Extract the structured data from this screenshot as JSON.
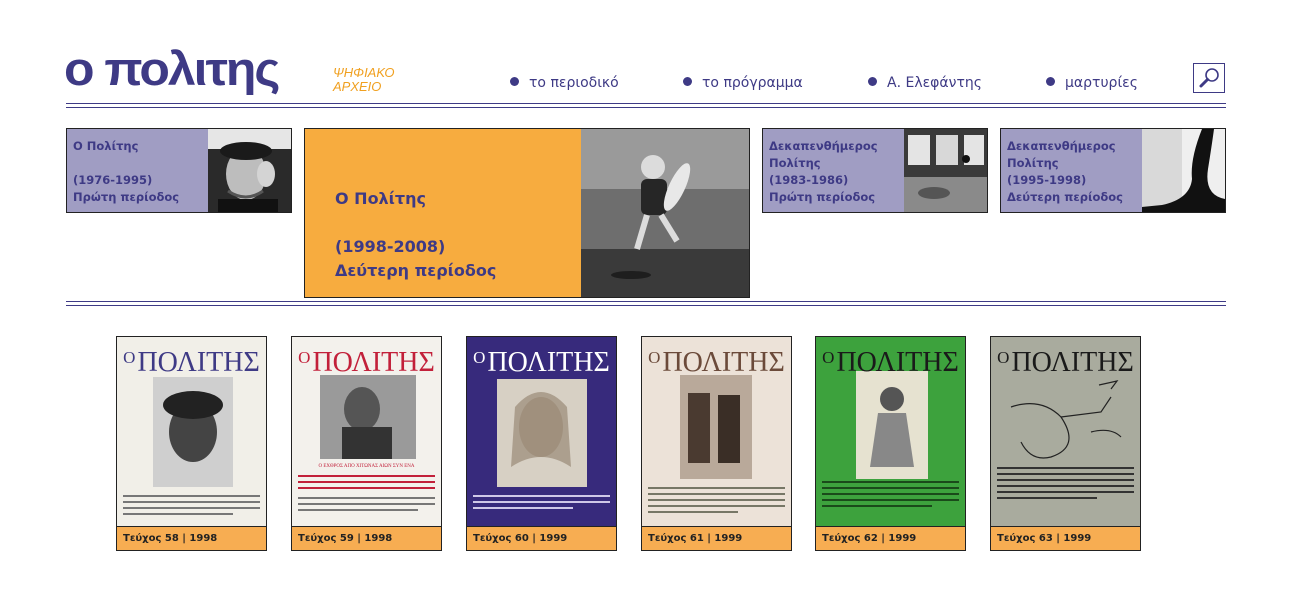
{
  "header": {
    "logo_text": "ο πολιτης",
    "logo_sub_line1": "ΨΗΦΙΑΚΟ",
    "logo_sub_line2": "ΑΡΧΕΙΟ",
    "search_icon": "search-icon"
  },
  "nav": [
    {
      "label": "το περιοδικό"
    },
    {
      "label": "το πρόγραμμα"
    },
    {
      "label": "Α. Ελεφάντης"
    },
    {
      "label": "μαρτυρίες"
    }
  ],
  "periods": [
    {
      "line1": "Ο Πολίτης",
      "line2": "",
      "line3": "(1976-1995)",
      "line4": "Πρώτη περίοδος"
    },
    {
      "line1": "Ο Πολίτης",
      "line2": "",
      "line3": "(1998-2008)",
      "line4": "Δεύτερη περίοδος"
    },
    {
      "line1": "Δεκαπενθήμερος",
      "line2": "Πολίτης",
      "line3": "(1983-1986)",
      "line4": "Πρώτη περίοδος"
    },
    {
      "line1": "Δεκαπενθήμερος",
      "line2": "Πολίτης",
      "line3": "(1995-1998)",
      "line4": "Δεύτερη περίοδος"
    }
  ],
  "issues": [
    {
      "masthead_o": "Ο",
      "masthead": "ΠΟΛΙΤΗΣ",
      "cover_headline": "",
      "caption": "Τεύχος 58 | 1998",
      "masthead_color": "#3e3a85",
      "cover_bg": "#f1efe8"
    },
    {
      "masthead_o": "Ο",
      "masthead": "ΠΟΛΙΤΗΣ",
      "cover_headline": "Ο ΕΧΘΡΟΣ ΑΠΟ ΧΙΤΩΝΑΣ ΑΙΩΝ ΣΥΝ ΕΝΑ",
      "caption": "Τεύχος 59 | 1998",
      "masthead_color": "#c2203a",
      "cover_bg": "#f3f1ec"
    },
    {
      "masthead_o": "Ο",
      "masthead": "ΠΟΛΙΤΗΣ",
      "cover_headline": "",
      "caption": "Τεύχος 60 | 1999",
      "masthead_color": "#ffffff",
      "cover_bg": "#372a7c"
    },
    {
      "masthead_o": "Ο",
      "masthead": "ΠΟΛΙΤΗΣ",
      "cover_headline": "",
      "caption": "Τεύχος 61 | 1999",
      "masthead_color": "#6b4a3a",
      "cover_bg": "#ece2d8"
    },
    {
      "masthead_o": "Ο",
      "masthead": "ΠΟΛΙΤΗΣ",
      "cover_headline": "",
      "caption": "Τεύχος 62 | 1999",
      "masthead_color": "#1a1a1a",
      "cover_bg": "#3da23d"
    },
    {
      "masthead_o": "Ο",
      "masthead": "ΠΟΛΙΤΗΣ",
      "cover_headline": "",
      "caption": "Τεύχος 63 | 1999",
      "masthead_color": "#1a1a1a",
      "cover_bg": "#a9ab9e"
    }
  ]
}
